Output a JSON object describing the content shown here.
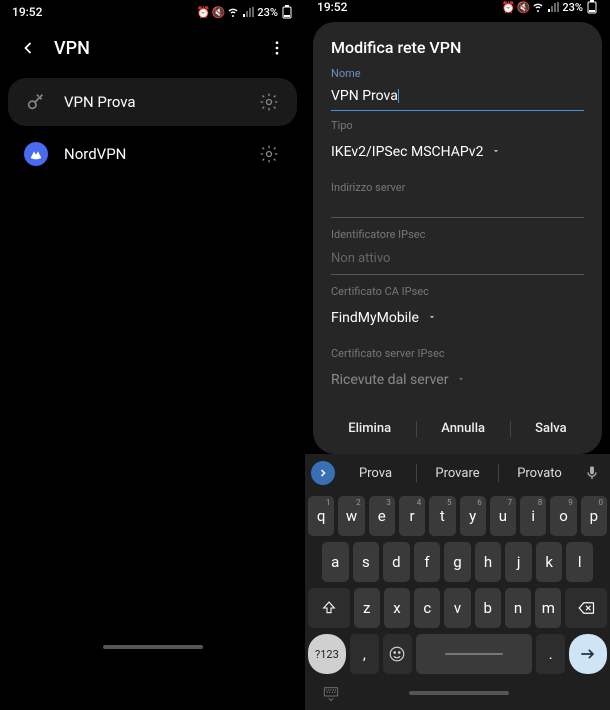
{
  "status": {
    "time": "19:52",
    "battery": "23%"
  },
  "left": {
    "title": "VPN",
    "items": [
      {
        "label": "VPN Prova"
      },
      {
        "label": "NordVPN"
      }
    ]
  },
  "right": {
    "modal": {
      "title": "Modifica rete VPN",
      "name_label": "Nome",
      "name_value": "VPN Prova",
      "type_label": "Tipo",
      "type_value": "IKEv2/IPSec MSCHAPv2",
      "server_label": "Indirizzo server",
      "server_value": "",
      "ipsec_id_label": "Identificatore IPsec",
      "ipsec_id_placeholder": "Non attivo",
      "ca_label": "Certificato CA IPsec",
      "ca_value": "FindMyMobile",
      "server_cert_label": "Certificato server IPsec",
      "server_cert_value": "Ricevute dal server",
      "btn_delete": "Elimina",
      "btn_cancel": "Annulla",
      "btn_save": "Salva"
    },
    "keyboard": {
      "suggestions": [
        "Prova",
        "Provare",
        "Provato"
      ],
      "row1": [
        {
          "k": "q",
          "n": "1"
        },
        {
          "k": "w",
          "n": "2"
        },
        {
          "k": "e",
          "n": "3"
        },
        {
          "k": "r",
          "n": "4"
        },
        {
          "k": "t",
          "n": "5"
        },
        {
          "k": "y",
          "n": "6"
        },
        {
          "k": "u",
          "n": "7"
        },
        {
          "k": "i",
          "n": "8"
        },
        {
          "k": "o",
          "n": "9"
        },
        {
          "k": "p",
          "n": "0"
        }
      ],
      "row2": [
        "a",
        "s",
        "d",
        "f",
        "g",
        "h",
        "j",
        "k",
        "l"
      ],
      "row3": [
        "z",
        "x",
        "c",
        "v",
        "b",
        "n",
        "m"
      ],
      "sym": "?123",
      "comma": ",",
      "period": "."
    }
  }
}
